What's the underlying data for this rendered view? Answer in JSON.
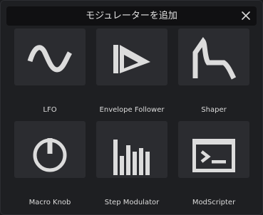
{
  "dialog": {
    "title": "モジュレーターを追加",
    "close_icon": "close-icon"
  },
  "modulators": [
    {
      "label": "LFO",
      "icon": "sine-wave-icon"
    },
    {
      "label": "Envelope Follower",
      "icon": "envelope-follower-icon"
    },
    {
      "label": "Shaper",
      "icon": "shaper-curve-icon"
    },
    {
      "label": "Macro Knob",
      "icon": "macro-knob-icon"
    },
    {
      "label": "Step Modulator",
      "icon": "step-bars-icon"
    },
    {
      "label": "ModScripter",
      "icon": "terminal-icon"
    }
  ],
  "colors": {
    "background": "#1e1f22",
    "titlebar": "#101012",
    "tile": "#2b2c30",
    "icon": "#dcdcdc",
    "text": "#dcdcdc"
  }
}
